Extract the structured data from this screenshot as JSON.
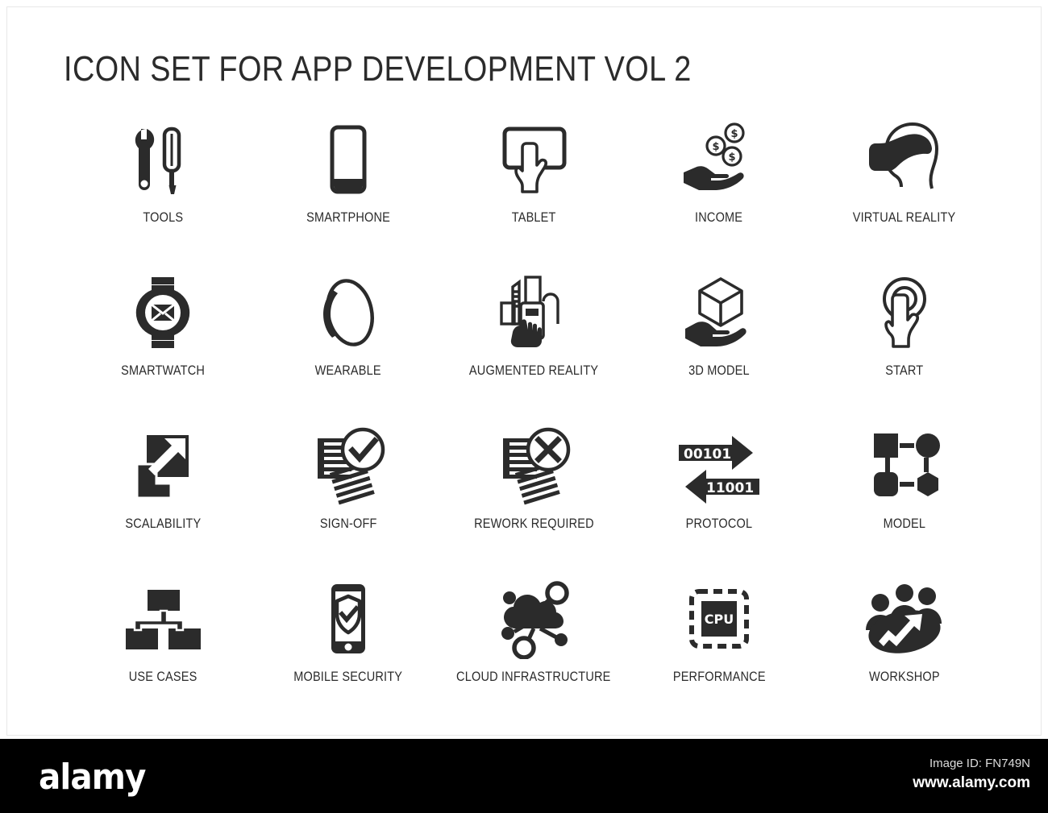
{
  "page": {
    "title": "ICON SET FOR APP DEVELOPMENT VOL 2",
    "background_color": "#ffffff",
    "icon_color": "#2b2b2b"
  },
  "icons": [
    {
      "id": "tools",
      "label": "TOOLS",
      "icon_name": "wrench-screwdriver-icon"
    },
    {
      "id": "smartphone",
      "label": "SMARTPHONE",
      "icon_name": "smartphone-icon"
    },
    {
      "id": "tablet",
      "label": "TABLET",
      "icon_name": "tablet-touch-hand-icon"
    },
    {
      "id": "income",
      "label": "INCOME",
      "icon_name": "hand-dollar-coins-icon"
    },
    {
      "id": "virtual-reality",
      "label": "VIRTUAL REALITY",
      "icon_name": "vr-headset-head-icon"
    },
    {
      "id": "smartwatch",
      "label": "SMARTWATCH",
      "icon_name": "smartwatch-envelope-icon"
    },
    {
      "id": "wearable",
      "label": "WEARABLE",
      "icon_name": "wearable-band-icon"
    },
    {
      "id": "augmented-reality",
      "label": "AUGMENTED REALITY",
      "icon_name": "hand-phone-buildings-icon"
    },
    {
      "id": "3d-model",
      "label": "3D MODEL",
      "icon_name": "hand-cube-icon"
    },
    {
      "id": "start",
      "label": "START",
      "icon_name": "finger-tap-circle-icon"
    },
    {
      "id": "scalability",
      "label": "SCALABILITY",
      "icon_name": "resize-diagonal-arrow-icon"
    },
    {
      "id": "sign-off",
      "label": "SIGN-OFF",
      "icon_name": "documents-check-icon"
    },
    {
      "id": "rework-required",
      "label": "REWORK REQUIRED",
      "icon_name": "documents-cross-icon"
    },
    {
      "id": "protocol",
      "label": "PROTOCOL",
      "icon_name": "binary-arrows-icon"
    },
    {
      "id": "model",
      "label": "MODEL",
      "icon_name": "shapes-network-icon"
    },
    {
      "id": "use-cases",
      "label": "USE CASES",
      "icon_name": "hierarchy-tree-icon"
    },
    {
      "id": "mobile-security",
      "label": "MOBILE SECURITY",
      "icon_name": "phone-shield-check-icon"
    },
    {
      "id": "cloud-infrastructure",
      "label": "CLOUD INFRASTRUCTURE",
      "icon_name": "cloud-network-icon"
    },
    {
      "id": "performance",
      "label": "PERFORMANCE",
      "icon_name": "cpu-chip-icon"
    },
    {
      "id": "workshop",
      "label": "WORKSHOP",
      "icon_name": "people-growth-arrow-icon"
    }
  ],
  "protocol_icon": {
    "top_bits": "00101",
    "bottom_bits": "11001"
  },
  "performance_icon": {
    "chip_label": "CPU"
  },
  "footer": {
    "logo": "alamy",
    "image_id": "Image ID: FN749N",
    "url": "www.alamy.com",
    "background_color": "#000000"
  }
}
